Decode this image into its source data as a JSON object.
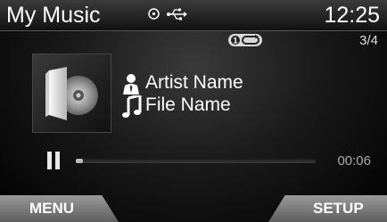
{
  "header": {
    "title": "My Music",
    "clock": "12:25",
    "icons": [
      "disc-icon",
      "usb-icon"
    ]
  },
  "status": {
    "mode_badge_icon": "repeat-one-icon",
    "track_count": "3/4"
  },
  "track": {
    "artist": "Artist Name",
    "file": "File Name",
    "art_icon": "folder-cd-icon"
  },
  "playback": {
    "state_icon": "pause-icon",
    "elapsed": "00:06",
    "progress": 0.02
  },
  "softkeys": {
    "menu": "MENU",
    "setup": "SETUP"
  },
  "colors": {
    "header_bg": "#2a2a2a",
    "softkey_bg": "#808080",
    "text": "#ffffff"
  }
}
